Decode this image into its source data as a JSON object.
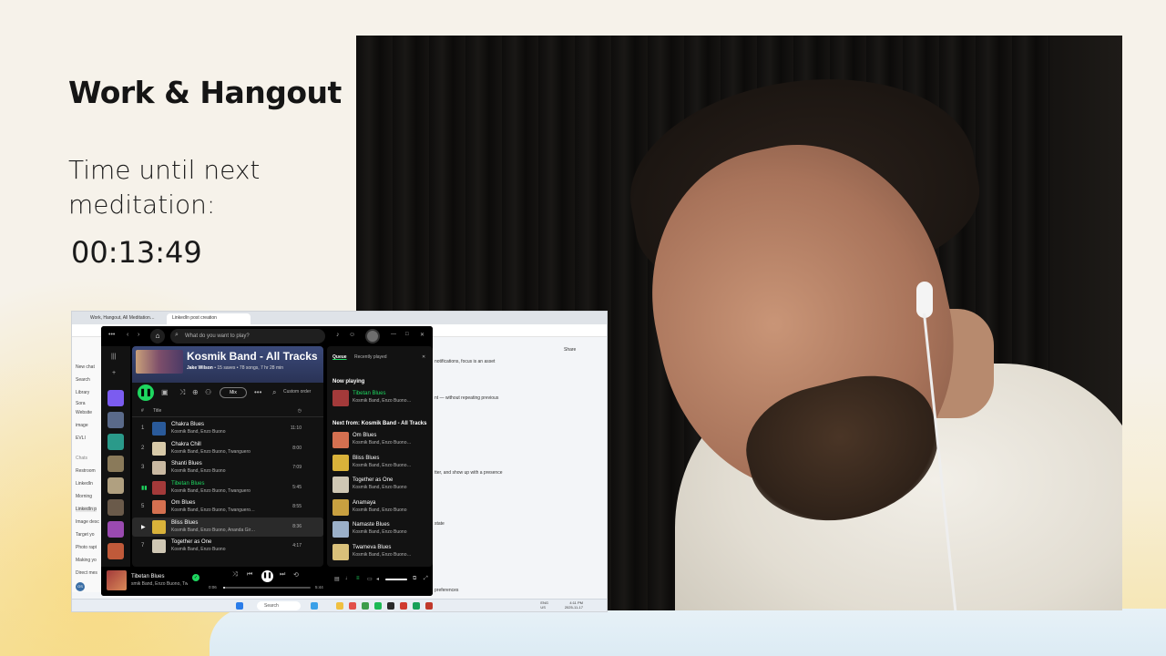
{
  "overlay": {
    "title": "Work & Hangout",
    "timer_label": "Time until next meditation:",
    "timer_value": "00:13:49"
  },
  "browser": {
    "tabs": [
      "Work, Hangout, All Meditation…",
      "LinkedIn post creation"
    ],
    "share_label": "Share",
    "sidebar": [
      "New chat",
      "Search",
      "Library",
      "Sora",
      "Website",
      "image",
      "EVLI",
      "Chats",
      "Restroom",
      "LinkedIn",
      "Morning",
      "LinkedIn p",
      "Image desc",
      "Target yo",
      "Photo rapt",
      "Making yo",
      "Direct mes"
    ],
    "user_initials": "OS",
    "chat_fragments": [
      "notifications, focus is an asset",
      "nt — without repeating previous",
      "tter, and show up with a presence",
      "state",
      "preferences"
    ]
  },
  "taskbar": {
    "search": "Search",
    "lang": "ENG\nUS",
    "clock": "4:11 PM\n2025-11-17"
  },
  "spotify": {
    "search_placeholder": "What do you want to play?",
    "playlist": {
      "title": "Kosmik Band - All Tracks",
      "owner": "Jake Wilson",
      "meta": "• 15 saves • 78 songs, 7 hr 28 min",
      "mix_label": "Mix",
      "sort_label": "Custom order",
      "col_num": "#",
      "col_title": "Title"
    },
    "tracks": [
      {
        "num": "1",
        "title": "Chakra Blues",
        "artist": "Kosmik Band, Enzo Buono",
        "duration": "11:10",
        "color": "#2a5a9a"
      },
      {
        "num": "2",
        "title": "Chakra Chill",
        "artist": "Kosmik Band, Enzo Buono, Twanguero",
        "duration": "8:00",
        "color": "#d7c9a8"
      },
      {
        "num": "3",
        "title": "Shanti Blues",
        "artist": "Kosmik Band, Enzo Buono",
        "duration": "7:09",
        "color": "#c9b9a2"
      },
      {
        "num": "",
        "title": "Tibetan Blues",
        "artist": "Kosmik Band, Enzo Buono, Twanguero",
        "duration": "5:45",
        "color": "#a33a3a",
        "playing": true
      },
      {
        "num": "5",
        "title": "Om Blues",
        "artist": "Kosmik Band, Enzo Buono, Twanguero…",
        "duration": "8:55",
        "color": "#d47050"
      },
      {
        "num": "",
        "title": "Bliss Blues",
        "artist": "Kosmik Band, Enzo Buono, Ananda Gir…",
        "duration": "8:36",
        "color": "#d9b23a",
        "hover": true
      },
      {
        "num": "7",
        "title": "Together as One",
        "artist": "Kosmik Band, Enzo Buono",
        "duration": "4:17",
        "color": "#cfc7b4"
      }
    ],
    "queue": {
      "tab_queue": "Queue",
      "tab_recent": "Recently played",
      "now_playing_label": "Now playing",
      "now_playing": {
        "title": "Tibetan Blues",
        "artist": "Kosmik Band, Enzo Buono…",
        "color": "#a33a3a"
      },
      "next_from_label": "Next from: Kosmik Band - All Tracks",
      "next": [
        {
          "title": "Om Blues",
          "artist": "Kosmik Band, Enzo Buono…",
          "color": "#d47050"
        },
        {
          "title": "Bliss Blues",
          "artist": "Kosmik Band, Enzo Buono…",
          "color": "#d9b23a"
        },
        {
          "title": "Together as One",
          "artist": "Kosmik Band, Enzo Buono",
          "color": "#cfc7b4"
        },
        {
          "title": "Anamaya",
          "artist": "Kosmik Band, Enzo Buono",
          "color": "#c8a040"
        },
        {
          "title": "Namaste Blues",
          "artist": "Kosmik Band, Enzo Buono",
          "color": "#9bb0c9"
        },
        {
          "title": "Twameva Blues",
          "artist": "Kosmik Band, Enzo Buono…",
          "color": "#d9c07a"
        }
      ]
    },
    "player": {
      "title": "Tibetan Blues",
      "artist": "smik Band, Enzo Buono, Twan",
      "elapsed": "0:06",
      "total": "5:44",
      "progress": 0.02
    },
    "accent_color": "#1ed760"
  }
}
